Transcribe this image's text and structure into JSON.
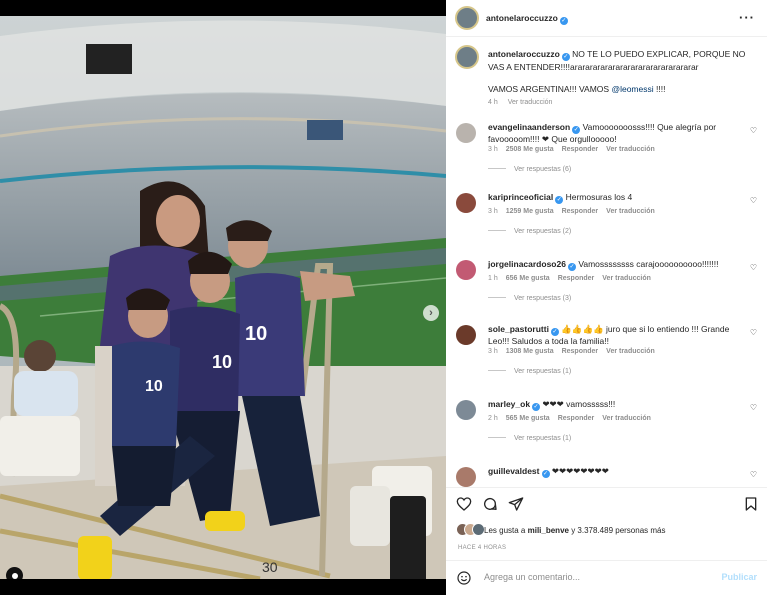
{
  "post": {
    "username": "antonelaroccuzzo",
    "caption_line1": "NO TE LO PUEDO EXPLICAR, PORQUE NO VAS A ENTENDER!!!!ararararararararararararararararar",
    "caption_line2_pre": "VAMOS ARGENTINA!!! VAMOS",
    "caption_mention": "@leomessi",
    "caption_line2_post": "!!!!",
    "time": "4 h",
    "see_translation": "Ver traducción",
    "more_icon": "more-options-icon"
  },
  "photo": {
    "jersey_number_1": "10",
    "jersey_number_2": "10",
    "jersey_number_3": "10",
    "step_number": "30"
  },
  "comments": [
    {
      "user": "evangelinaanderson",
      "text": "Vamooooooosss!!!! Que alegría por favooooom!!!! ❤ Que orgullooooo!",
      "time": "3 h",
      "likes": "2508 Me gusta",
      "reply": "Responder",
      "translate": "Ver traducción",
      "replies": "Ver respuestas (6)",
      "color": "#b9b3ad"
    },
    {
      "user": "kariprinceoficial",
      "text": "Hermosuras los 4",
      "time": "3 h",
      "likes": "1259 Me gusta",
      "reply": "Responder",
      "translate": "Ver traducción",
      "replies": "Ver respuestas (2)",
      "color": "#8a4a3c"
    },
    {
      "user": "jorgelinacardoso26",
      "text": "Vamossssssss carajoooooooooo!!!!!!!",
      "time": "1 h",
      "likes": "656 Me gusta",
      "reply": "Responder",
      "translate": "Ver traducción",
      "replies": "Ver respuestas (3)",
      "color": "#c25a73"
    },
    {
      "user": "sole_pastorutti",
      "text": "👍👍👍👍 juro que si lo entiendo !!! Grande Leo!!! Saludos a toda la familia!!",
      "time": "3 h",
      "likes": "1308 Me gusta",
      "reply": "Responder",
      "translate": "Ver traducción",
      "replies": "Ver respuestas (1)",
      "color": "#6b3a2a"
    },
    {
      "user": "marley_ok",
      "text": "❤❤❤ vamosssss!!!",
      "time": "2 h",
      "likes": "565 Me gusta",
      "reply": "Responder",
      "translate": "Ver traducción",
      "replies": "Ver respuestas (1)",
      "color": "#7d8a96"
    },
    {
      "user": "guillevaldest",
      "text": "❤❤❤❤❤❤❤❤",
      "time": "",
      "likes": "",
      "reply": "",
      "translate": "",
      "replies": "",
      "color": "#a97a6a"
    }
  ],
  "actions": {
    "likes_text_pre": "Les gusta a",
    "likes_user": "mili_benve",
    "likes_text_post": "y 3.378.489 personas más",
    "ago": "HACE 4 HORAS",
    "comment_placeholder": "Agrega un comentario...",
    "publish": "Publicar"
  },
  "colors": {
    "verified": "#3897f0",
    "publish": "#b2dffc",
    "heart": "#ed4956"
  }
}
